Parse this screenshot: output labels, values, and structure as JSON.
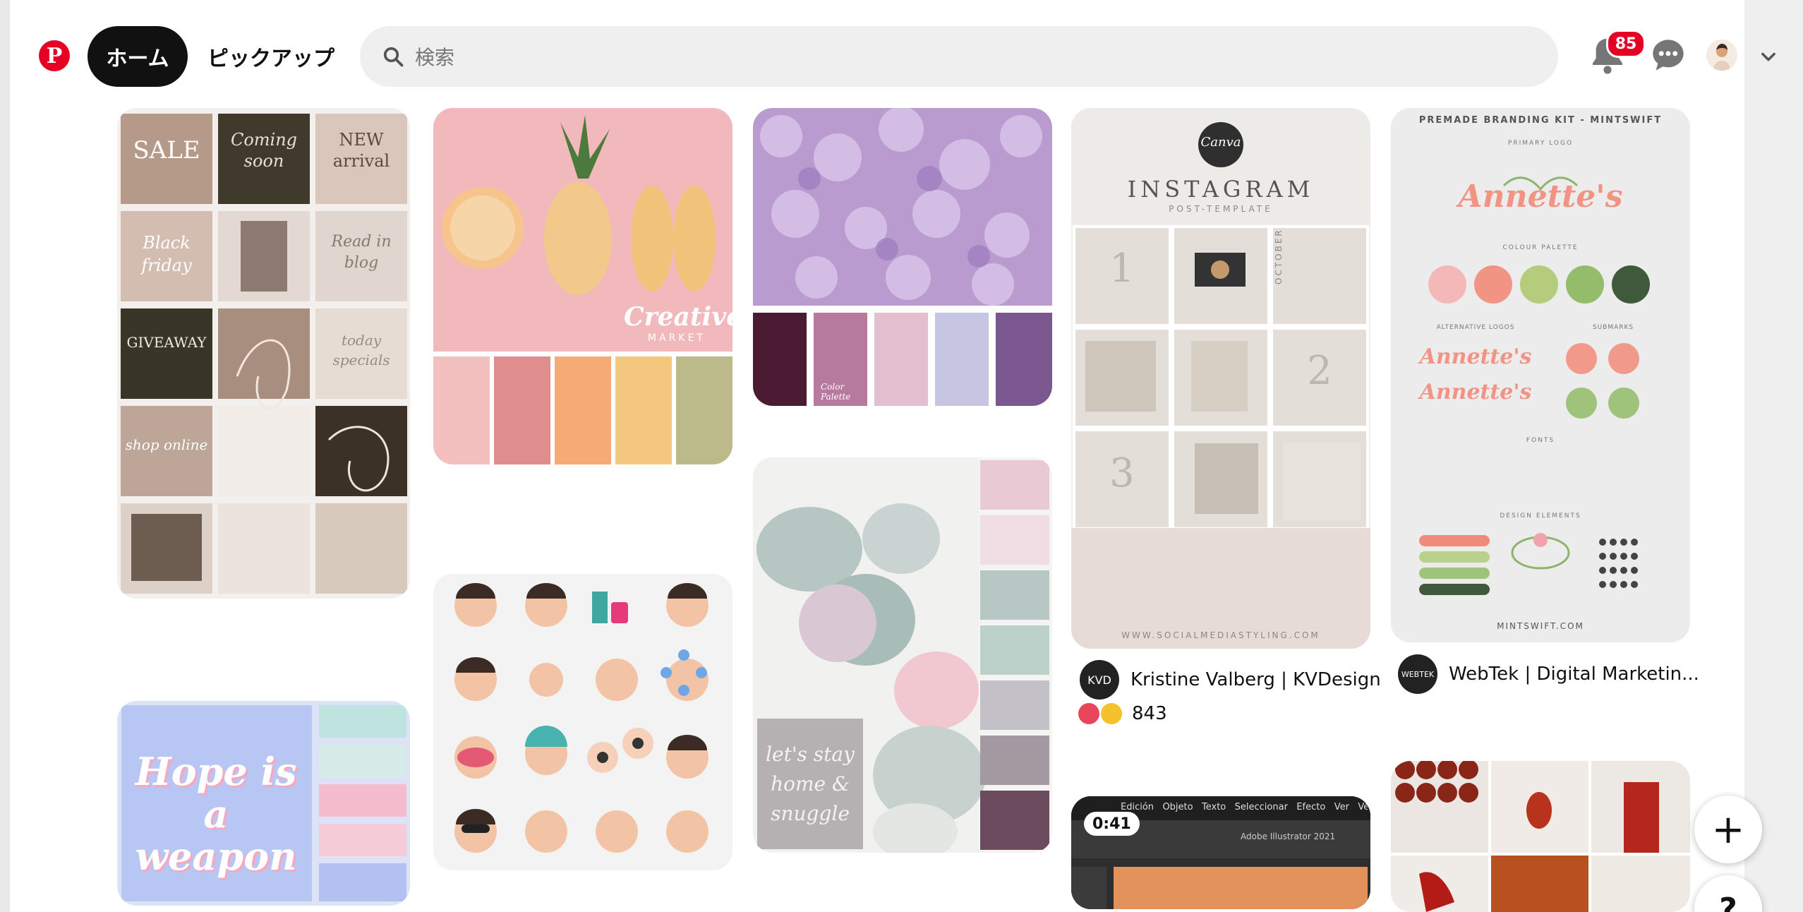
{
  "header": {
    "logo_letter": "P",
    "home_label": "ホーム",
    "pickup_label": "ピックアップ",
    "search_placeholder": "検索",
    "notification_count": "85"
  },
  "pins": {
    "p1": {
      "texts": [
        "SALE",
        "Coming soon",
        "NEW arrival",
        "Black friday",
        "Read in blog",
        "GIVEAWAY",
        "today specials",
        "shop online"
      ]
    },
    "p2": {
      "text": "Creative",
      "sub": "MARKET",
      "swatches": [
        "#f3c0bf",
        "#de8f8d",
        "#f6ab76",
        "#f4c77f",
        "#bcb98b"
      ]
    },
    "p3": {
      "label": "Color Palette",
      "swatches": [
        "#4b1b33",
        "#b77a9f",
        "#e4bfd0",
        "#c6c5e2",
        "#7a578f"
      ]
    },
    "p4": {
      "logo": "Canva",
      "title": "INSTAGRAM",
      "subtitle": "POST-TEMPLATE",
      "grid": [
        "1",
        "2",
        "3"
      ],
      "month": "OCTOBER",
      "footer": "WWW.SOCIALMEDIASTYLING.COM",
      "creator": "Kristine Valberg | KVDesign",
      "creator_initials": "KVD",
      "reactions": "843"
    },
    "p5": {
      "heading": "PREMADE BRANDING KIT - MINTSWIFT",
      "primary_logo": "PRIMARY LOGO",
      "brand": "Annette's",
      "colour_palette": "COLOUR PALETTE",
      "palette": [
        "#f5b8b8",
        "#f19483",
        "#b5cc7c",
        "#93bd6b",
        "#3f5a3b"
      ],
      "alt_logos": "ALTERNATIVE LOGOS",
      "submarks": "SUBMARKS",
      "fonts": "FONTS",
      "design_elements": "DESIGN ELEMENTS",
      "footer": "MINTSWIFT.COM",
      "creator": "WebTek | Digital Marketin...",
      "creator_initials": "WEBTEK"
    },
    "p6": {
      "text": "Hope is a weapon",
      "swatches": [
        "#bfe3df",
        "#d7ece9",
        "#f4bccd",
        "#f7ccd9",
        "#b2c1f2"
      ]
    },
    "p8": {
      "swatches": [
        "#e9c9d3",
        "#f1dde4",
        "#b7c8c4",
        "#bcd1c9",
        "#c3c1c7",
        "#a39aa1",
        "#6b4b5d"
      ],
      "script": "let's stay home & snuggle"
    },
    "p9": {
      "duration": "0:41",
      "menu": [
        "Edición",
        "Objeto",
        "Texto",
        "Seleccionar",
        "Efecto",
        "Ver",
        "Ventana"
      ],
      "app": "Adobe Illustrator 2021"
    }
  },
  "fab": {
    "add": "+",
    "help": "?"
  }
}
